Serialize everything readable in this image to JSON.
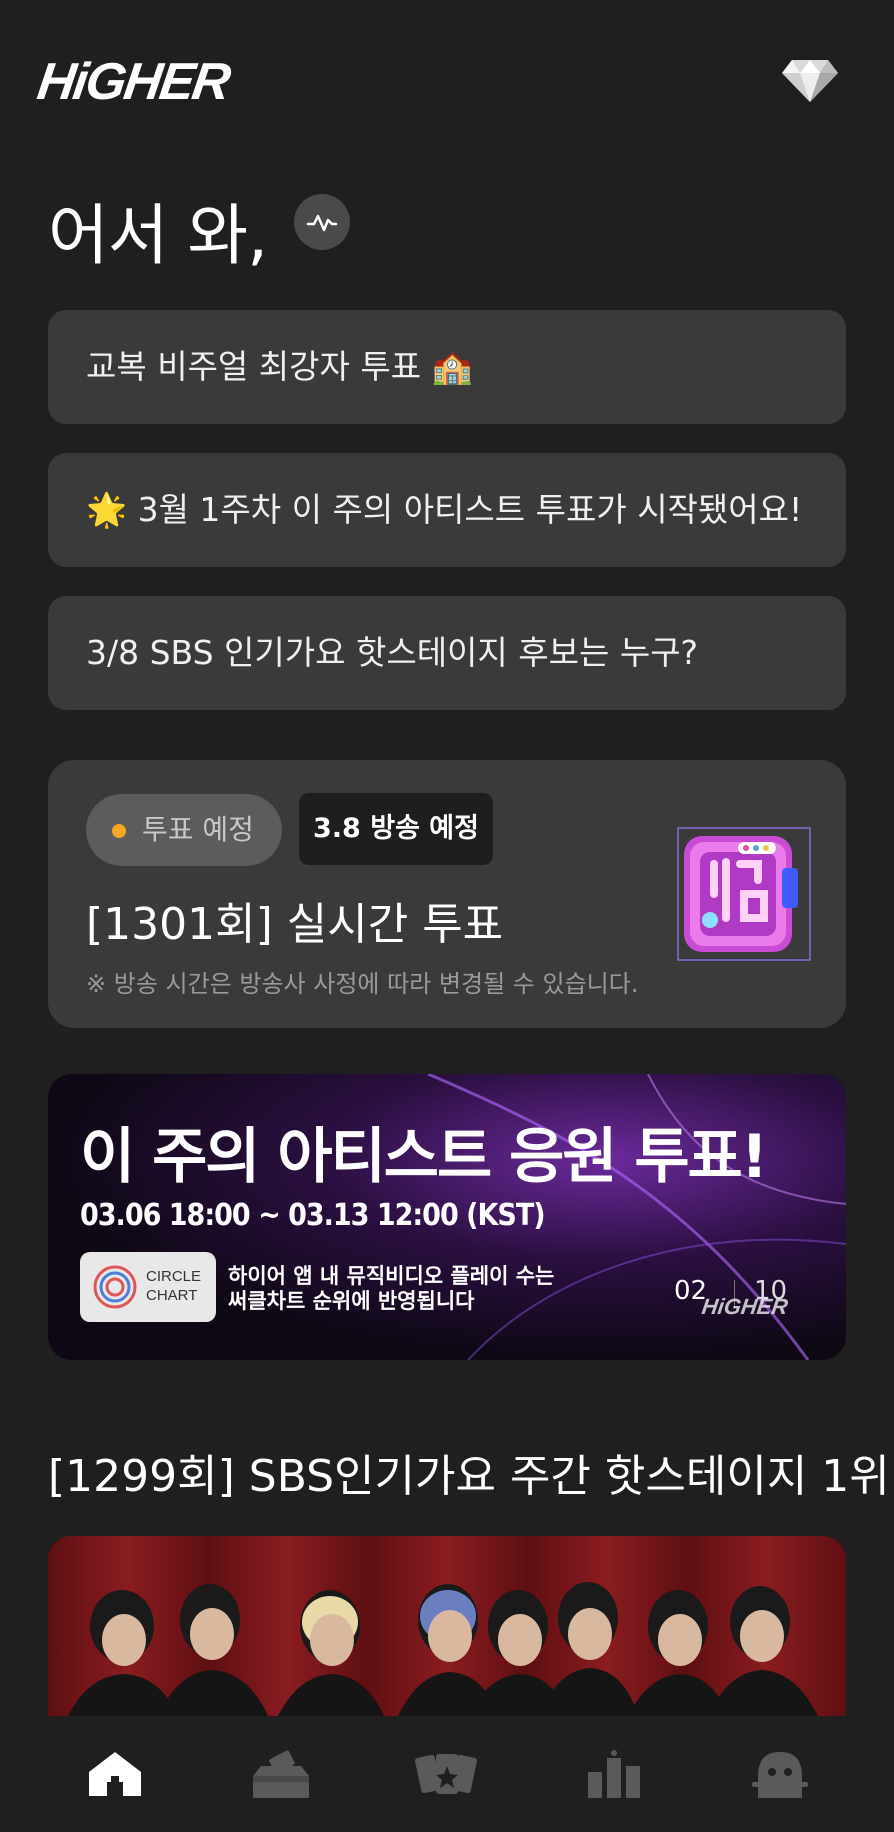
{
  "header": {
    "logo_text": "HiGHER",
    "gem_icon": "diamond-icon"
  },
  "welcome": {
    "greeting": "어서 와,",
    "badge_icon": "pulse-icon"
  },
  "notices": [
    {
      "text": "교복 비주얼 최강자 투표 🏫"
    },
    {
      "text": "🌟 3월 1주차 이 주의 아티스트 투표가 시작됐어요!"
    },
    {
      "text": "3/8 SBS 인기가요 핫스테이지 후보는 누구?"
    }
  ],
  "vote_card": {
    "status": "투표 예정",
    "status_color": "#f5a623",
    "air_badge": "3.8 방송 예정",
    "title": "[1301회] 실시간 투표",
    "note": "※ 방송 시간은 방송사 사정에 따라 변경될 수 있습니다."
  },
  "banner": {
    "title": "이 주의 아티스트 응원 투표!",
    "date": "03.06 18:00 ~ 03.13 12:00 (KST)",
    "circle_text_1": "CIRCLE",
    "circle_text_2": "CHART",
    "desc_line1": "하이어 앱 내 뮤직비디오 플레이 수는",
    "desc_line2": "써클차트 순위에 반영됩니다",
    "page_current": "02",
    "page_total": "10",
    "watermark": "HiGHER"
  },
  "section": {
    "title": "[1299회] SBS인기가요 주간 핫스테이지 1위"
  },
  "tabbar": {
    "items": [
      {
        "icon": "home-icon",
        "active": true
      },
      {
        "icon": "vote-box-icon",
        "active": false
      },
      {
        "icon": "cards-icon",
        "active": false
      },
      {
        "icon": "ranking-icon",
        "active": false
      },
      {
        "icon": "profile-icon",
        "active": false
      }
    ]
  }
}
